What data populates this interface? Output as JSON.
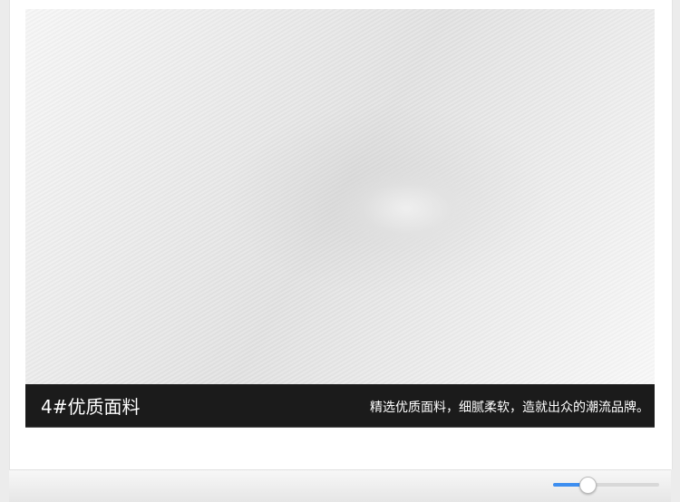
{
  "product": {
    "caption_title": "4#优质面料",
    "caption_desc": "精选优质面料，细腻柔软，造就出众的潮流品牌。"
  },
  "slider": {
    "value_percent": 32,
    "fill_color": "#3d8ef0"
  }
}
